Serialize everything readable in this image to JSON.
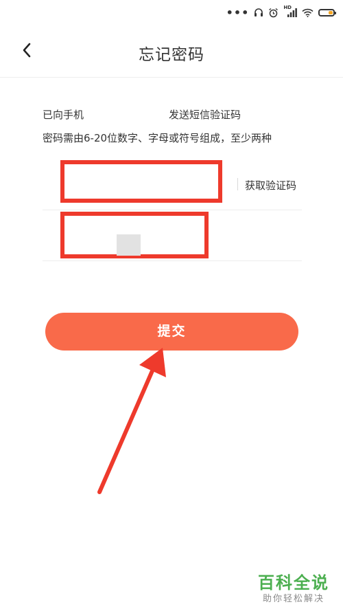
{
  "status_bar": {
    "dots": "•••",
    "hd_label": "HD",
    "battery_level": 0.35,
    "icons": [
      "headphones-icon",
      "alarm-icon",
      "cellular-signal-icon",
      "wifi-icon",
      "battery-icon"
    ]
  },
  "header": {
    "title": "忘记密码",
    "back_icon": "chevron-left-icon"
  },
  "info": {
    "line1_start": "已向手机",
    "line1_end": "发送短信验证码",
    "line2": "密码需由6-20位数字、字母或符号组成，至少两种"
  },
  "form": {
    "get_code_label": "获取验证码"
  },
  "submit": {
    "label": "提交"
  },
  "watermark": {
    "title": "百科全说",
    "subtitle": "助你轻松解决"
  },
  "colors": {
    "accent": "#f96a4a",
    "annotation": "#ee3a2c",
    "watermark": "#4caf50"
  }
}
